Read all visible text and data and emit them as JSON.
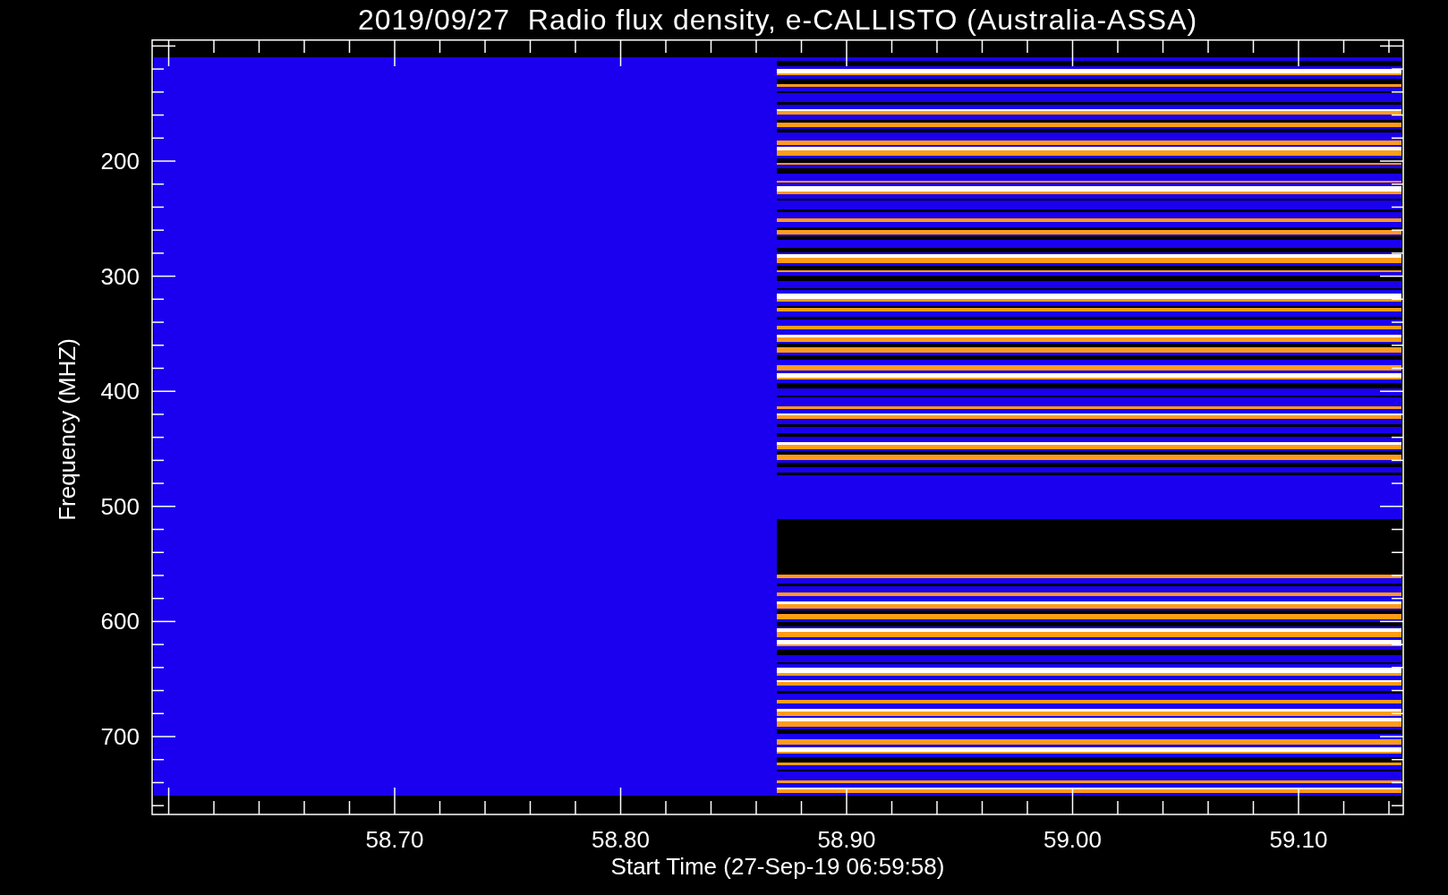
{
  "title": "2019/09/27  Radio flux density, e-CALLISTO (Australia-ASSA)",
  "plot": {
    "y_label": "Frequency (MHZ)",
    "y_tick_labels": [
      "200",
      "300",
      "400",
      "500",
      "600",
      "700"
    ],
    "x_label": "Start Time (27-Sep-19 06:59:58)",
    "x_tick_labels": [
      "58.70",
      "58.80",
      "58.90",
      "59.00",
      "59.10"
    ]
  }
}
